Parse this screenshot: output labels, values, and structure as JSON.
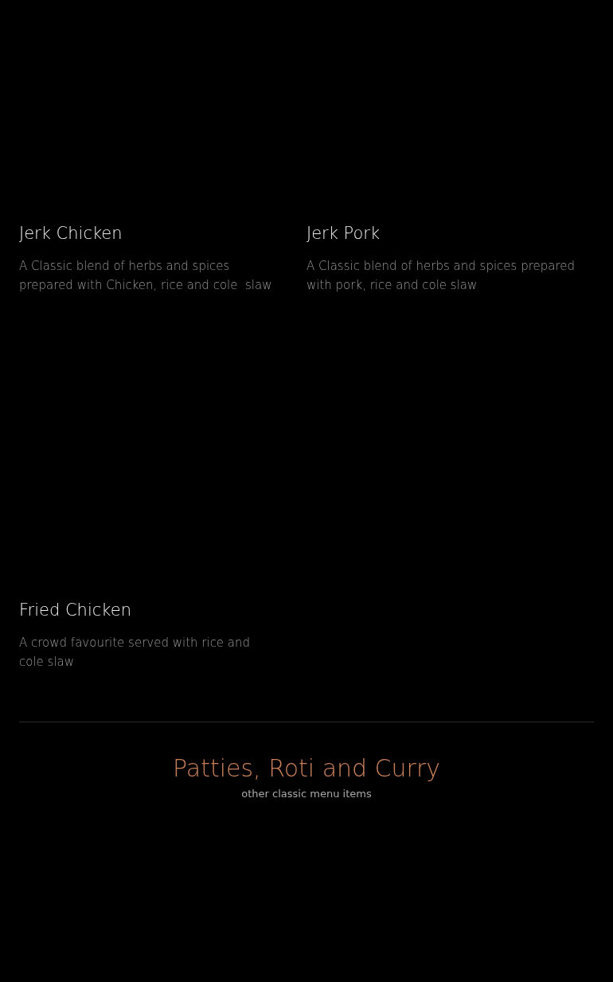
{
  "menu_items": [
    {
      "name": "Jerk Chicken",
      "description": "A Classic blend of herbs and spices prepared with Chicken, rice and cole  slaw"
    },
    {
      "name": "Jerk Pork",
      "description": "A Classic blend of herbs and spices prepared with pork, rice and cole slaw"
    },
    {
      "name": "Fried Chicken",
      "description": "A crowd favourite served with rice and cole slaw"
    }
  ],
  "section": {
    "title": "Patties, Roti and Curry",
    "subtitle": "other classic menu items"
  }
}
